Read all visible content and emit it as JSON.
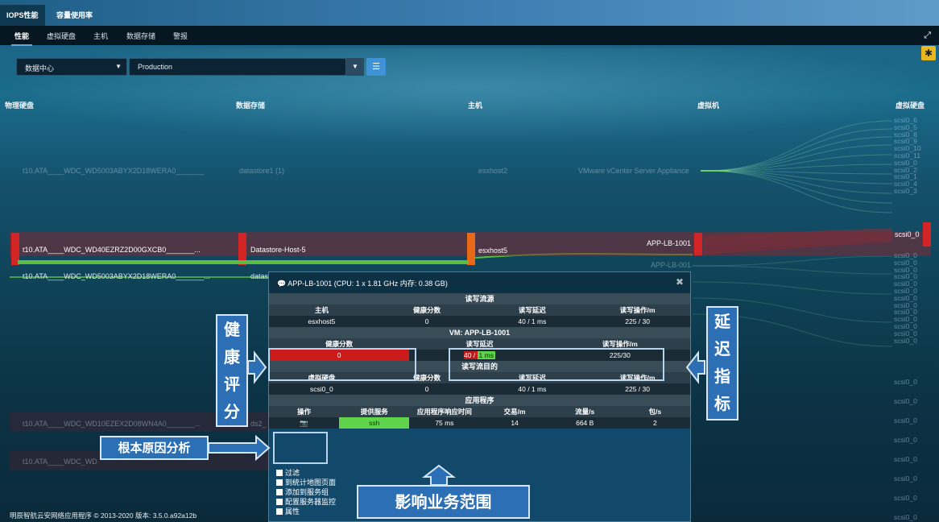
{
  "top_tabs": {
    "iops": "IOPS性能",
    "capacity": "容量使用率"
  },
  "sub_tabs": {
    "performance": "性能",
    "vdisk": "虚拟硬盘",
    "host": "主机",
    "datastore": "数据存储",
    "alerts": "警报"
  },
  "filters": {
    "scope": "数据中心",
    "value": "Production"
  },
  "columns": {
    "physical_disk": "物理硬盘",
    "datastore": "数据存储",
    "host": "主机",
    "vm": "虚拟机",
    "virtual_disk": "虚拟硬盘"
  },
  "faded_row": {
    "disk": "t10.ATA____WDC_WD5003ABYX2D18WERA0_______",
    "datastore": "datastore1 (1)",
    "host": "esxhost2",
    "vm": "VMware vCenter Server Appliance"
  },
  "scsi_top": [
    "scsi0_6",
    "scsi0_5",
    "scsi0_8",
    "scsi0_9",
    "scsi0_10",
    "scsi0_11",
    "scsi0_0",
    "scsi0_2",
    "scsi0_1",
    "scsi0_4",
    "scsi0_3"
  ],
  "hl_row": {
    "disk": "t10.ATA____WDC_WD40EZRZ2D00GXCB0_______...",
    "datastore": "Datastore-Host-5",
    "host": "esxhost5",
    "vm": "APP-LB-1001",
    "vm_sub": "APP-LB-001",
    "scsi": "scsi0_0"
  },
  "row2": {
    "disk": "t10.ATA____WDC_WD5003ABYX2D18WERA0_______...",
    "datastore": "datas"
  },
  "row3": {
    "disk": "t10.ATA____WDC_WD10EZEX2D08WN4A0_______...",
    "datastore": "ds2_"
  },
  "row4": {
    "disk": "t10.ATA____WDC_WD"
  },
  "scsi_lower": [
    "scsi0_0",
    "scsi0_0",
    "scsi0_0",
    "scsi0_0",
    "scsi0_0",
    "scsi0_0",
    "scsi0_0",
    "scsi0_0",
    "scsi0_0",
    "scsi0_0",
    "scsi0_0",
    "scsi0_0",
    "scsi0_0"
  ],
  "scsi_bottom": [
    "scsi0_0",
    "scsi0_0",
    "scsi0_0",
    "scsi0_0",
    "scsi0_0",
    "scsi0_0",
    "scsi0_0",
    "scsi0_0",
    "scsi0_0"
  ],
  "popup": {
    "title": "APP-LB-1001 (CPU: 1 x 1.81 GHz 内存: 0.38 GB)",
    "sec1": "读写流源",
    "t1_head": [
      "主机",
      "健康分数",
      "读写延迟",
      "读写操作/m"
    ],
    "t1_row": [
      "esxhost5",
      "0",
      "40 / 1 ms",
      "225 / 30"
    ],
    "sec2": "VM: APP-LB-1001",
    "t2_head": [
      "健康分数",
      "读写延迟",
      "读写操作/m"
    ],
    "t2_health": "0",
    "t2_lat_a": "40 / ",
    "t2_lat_b": "1 ms",
    "t2_ops": "225/30",
    "sec3": "读写流目的",
    "t3_head": [
      "虚拟硬盘",
      "健康分数",
      "读写延迟",
      "读写操作/m"
    ],
    "t3_row": [
      "scsi0_0",
      "0",
      "40 / 1 ms",
      "225 / 30"
    ],
    "sec4": "应用程序",
    "t4_head": [
      "操作",
      "提供服务",
      "应用程序响应时间",
      "交易/m",
      "流量/s",
      "包/s"
    ],
    "t4_row": [
      "ssh",
      "75 ms",
      "14",
      "664 B",
      "2"
    ],
    "menu": [
      "过滤",
      "到统计地图页面",
      "添加到服务组",
      "配置服务器监控",
      "属性"
    ]
  },
  "annotations": {
    "health": [
      "健",
      "康",
      "评",
      "分"
    ],
    "latency": [
      "延",
      "迟",
      "指",
      "标"
    ],
    "root_cause": "根本原因分析",
    "impact": "影响业务范围"
  },
  "footer": "明辰智航云安网络应用程序 © 2013-2020 版本: 3.5.0.a92a12b"
}
